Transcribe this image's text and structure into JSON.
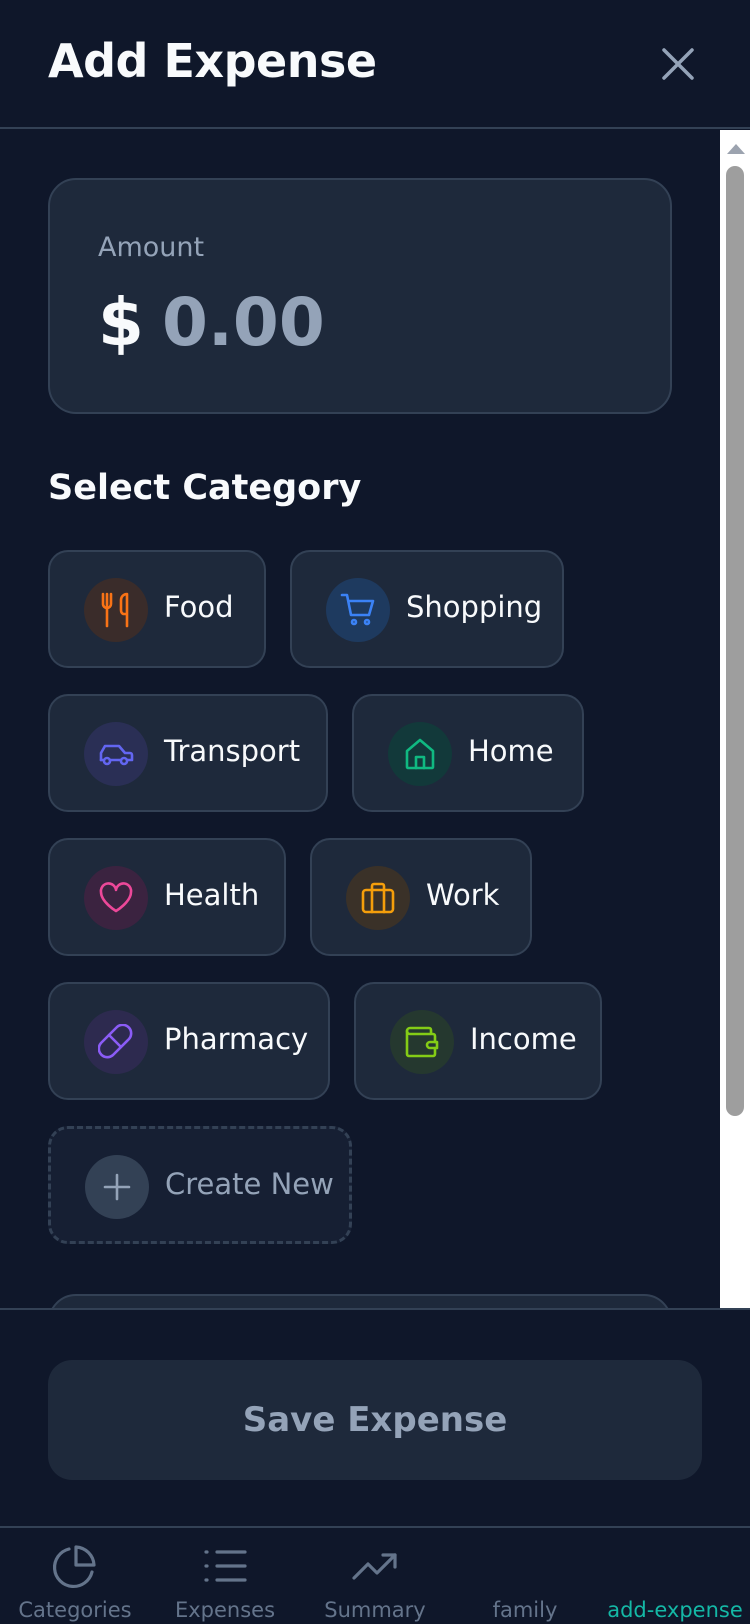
{
  "header": {
    "title": "Add Expense",
    "close_icon": "close-icon"
  },
  "amount": {
    "label": "Amount",
    "currency": "$",
    "value": "0.00"
  },
  "category_section": {
    "title": "Select Category"
  },
  "categories": [
    {
      "label": "Food",
      "icon": "utensils-icon",
      "color": "#f97316"
    },
    {
      "label": "Shopping",
      "icon": "cart-icon",
      "color": "#3b82f6"
    },
    {
      "label": "Transport",
      "icon": "car-icon",
      "color": "#6366f1"
    },
    {
      "label": "Home",
      "icon": "home-icon",
      "color": "#10b981"
    },
    {
      "label": "Health",
      "icon": "heart-icon",
      "color": "#ec4899"
    },
    {
      "label": "Work",
      "icon": "briefcase-icon",
      "color": "#f59e0b"
    },
    {
      "label": "Pharmacy",
      "icon": "pill-icon",
      "color": "#8b5cf6"
    },
    {
      "label": "Income",
      "icon": "wallet-icon",
      "color": "#84cc16"
    }
  ],
  "create_new": {
    "label": "Create New",
    "icon": "plus-icon"
  },
  "footer": {
    "save_label": "Save Expense"
  },
  "tabs": [
    {
      "label": "Categories",
      "icon": "pie-chart-icon"
    },
    {
      "label": "Expenses",
      "icon": "list-icon"
    },
    {
      "label": "Summary",
      "icon": "trending-up-icon"
    },
    {
      "label": "family",
      "icon": ""
    },
    {
      "label": "add-expense",
      "icon": "",
      "active": true
    }
  ],
  "colors": {
    "background": "#0f172a",
    "card": "#1e293b",
    "border": "#334155",
    "muted": "#94a3b8",
    "accent": "#14b8a6"
  }
}
